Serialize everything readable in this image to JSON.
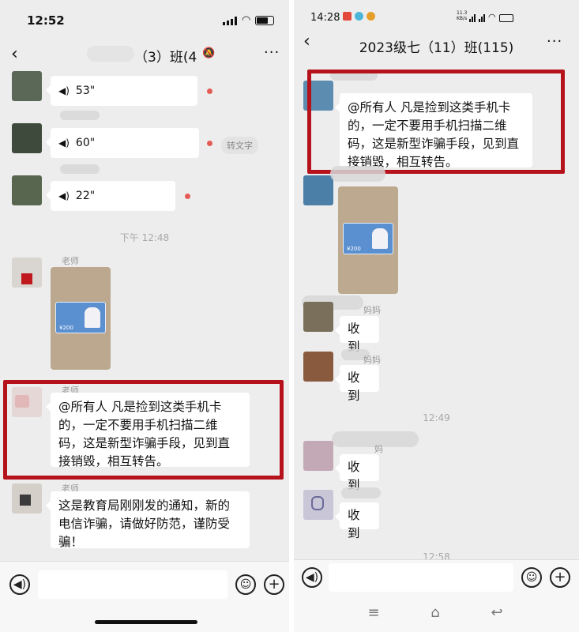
{
  "left": {
    "status_time": "12:52",
    "title": "（3）班(4",
    "voice_messages": [
      {
        "duration": "53\""
      },
      {
        "duration": "60\"",
        "action": "转文字"
      },
      {
        "duration": "22\""
      }
    ],
    "timestamp": "下午 12:48",
    "sender_teacher": "老师",
    "highlighted_message": "@所有人 凡是捡到这类手机卡的，一定不要用手机扫描二维码，这是新型诈骗手段，见到直接销毁，相互转告。",
    "last_message": "这是教育局刚刚发的通知，新的电信诈骗，请做好防范，谨防受骗！",
    "card_label": "¥200"
  },
  "right": {
    "status_time": "14:28",
    "status_right": "11.3 KB/s",
    "title": "2023级七（11）班(115)",
    "highlighted_message": "@所有人  凡是捡到这类手机卡的，一定不要用手机扫描二维码，这是新型诈骗手段，见到直接销毁，相互转告。",
    "sender_mom": "妈妈",
    "sender_mom_alt": "妈",
    "replies": [
      "收到",
      "收到",
      "收到",
      "收到"
    ],
    "timestamp_1": "12:49",
    "timestamp_2": "12:58",
    "card_label": "¥200"
  },
  "icons": {
    "back": "back-chevron-icon",
    "more": "more-dots-icon",
    "voice": "voice-input-icon",
    "emoji": "emoji-icon",
    "add": "add-icon"
  },
  "colors": {
    "highlight_border": "#b5121b",
    "unread_dot": "#e45b54",
    "chat_background": "#ededed"
  }
}
